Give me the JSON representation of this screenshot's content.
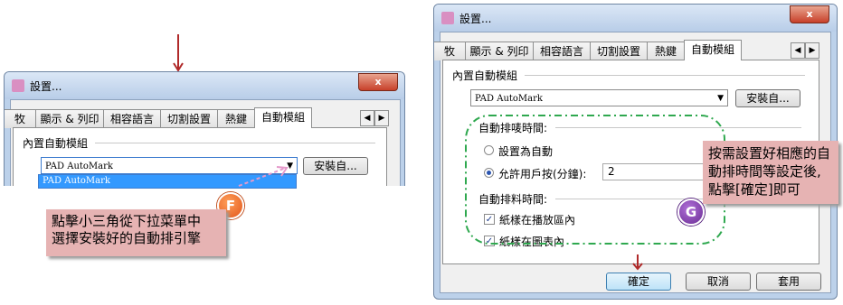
{
  "left_dialog": {
    "title": "設置...",
    "close": "x",
    "tabs": [
      "牧",
      "顯示 & 列印",
      "相容語言",
      "切割設置",
      "熱鍵",
      "自動模組"
    ],
    "active_tab": "自動模組",
    "group_label": "內置自動模組",
    "combo_value": "PAD AutoMark",
    "install_button": "安裝自...",
    "dropdown_item": "PAD AutoMark"
  },
  "right_dialog": {
    "title": "設置...",
    "close": "x",
    "tabs": [
      "牧",
      "顯示 & 列印",
      "相容語言",
      "切割設置",
      "熱鍵",
      "自動模組"
    ],
    "active_tab": "自動模組",
    "group_label": "內置自動模組",
    "combo_value": "PAD AutoMark",
    "install_button": "安裝自...",
    "auto_typeset_time_label": "自動排唛時間:",
    "radio_auto": "設置為自動",
    "radio_user": "允許用戶按(分鐘):",
    "user_minutes": "2",
    "auto_material_label": "自動排料時間:",
    "check_play_area": "紙樣在播放區內",
    "check_in_chart": "紙樣在圖表內",
    "ok": "確定",
    "cancel": "取消",
    "apply": "套用"
  },
  "callout_f": {
    "badge": "F",
    "line1": "點擊小三角從下拉菜單中",
    "line2": "選擇安裝好的自動排引擎"
  },
  "callout_g": {
    "badge": "G",
    "line1": "按需設置好相應的自",
    "line2": "動排時間等設定後,",
    "line3": "點擊[確定]即可"
  },
  "colors": {
    "callout_bg": "#e6b3b3",
    "badge_purple": "#7a3fa0",
    "arrow_red": "#b02a2a",
    "dash_green": "#2fa84f"
  }
}
